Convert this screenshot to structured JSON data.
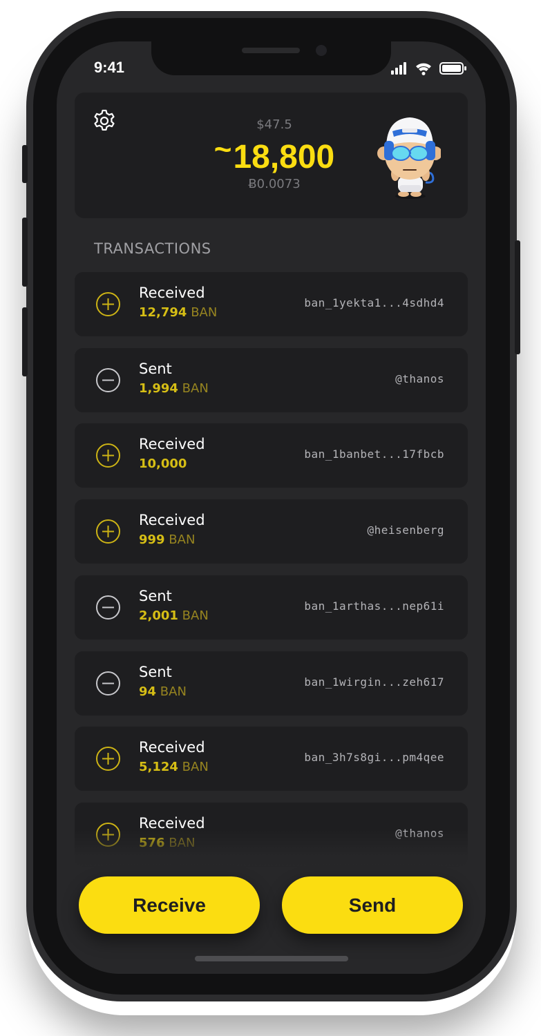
{
  "status_bar": {
    "time": "9:41"
  },
  "header": {
    "fiat_value": "$47.5",
    "balance_prefix": "~",
    "balance": "18,800",
    "btc_value": "Ƀ0.0073"
  },
  "section_title": "TRANSACTIONS",
  "transactions": [
    {
      "type": "Received",
      "amount": "12,794",
      "unit": "BAN",
      "address": "ban_1yekta1...4sdhd4",
      "icon": "plus-circle-icon"
    },
    {
      "type": "Sent",
      "amount": "1,994",
      "unit": "BAN",
      "address": "@thanos",
      "icon": "minus-circle-icon"
    },
    {
      "type": "Received",
      "amount": "10,000",
      "unit": "",
      "address": "ban_1banbet...17fbcb",
      "icon": "plus-circle-icon"
    },
    {
      "type": "Received",
      "amount": "999",
      "unit": "BAN",
      "address": "@heisenberg",
      "icon": "plus-circle-icon"
    },
    {
      "type": "Sent",
      "amount": "2,001",
      "unit": "BAN",
      "address": "ban_1arthas...nep61i",
      "icon": "minus-circle-icon"
    },
    {
      "type": "Sent",
      "amount": "94",
      "unit": "BAN",
      "address": "ban_1wirgin...zeh617",
      "icon": "minus-circle-icon"
    },
    {
      "type": "Received",
      "amount": "5,124",
      "unit": "BAN",
      "address": "ban_3h7s8gi...pm4qee",
      "icon": "plus-circle-icon"
    },
    {
      "type": "Received",
      "amount": "576",
      "unit": "BAN",
      "address": "@thanos",
      "icon": "plus-circle-icon"
    }
  ],
  "actions": {
    "receive": "Receive",
    "send": "Send"
  },
  "colors": {
    "accent": "#fbdd11",
    "card": "#1e1e20",
    "background": "#272729",
    "amount": "#d6be15"
  }
}
